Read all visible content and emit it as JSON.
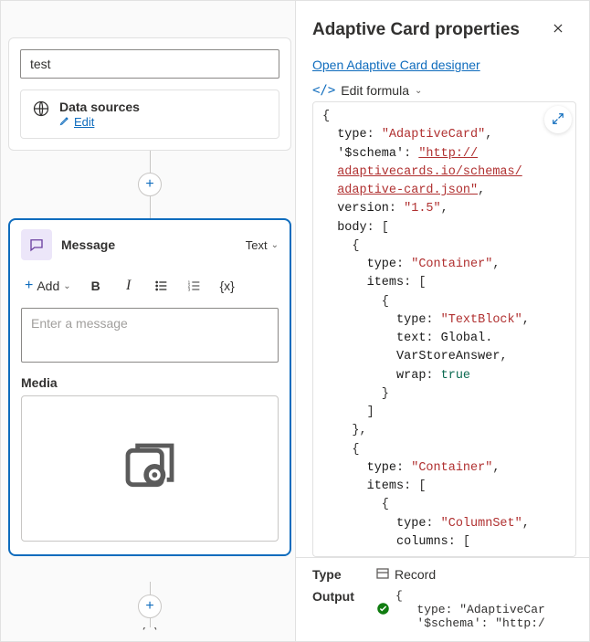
{
  "canvas": {
    "search_value": "test",
    "data_sources": {
      "title": "Data sources",
      "edit_label": "Edit"
    },
    "message_node": {
      "title": "Message",
      "type_label": "Text",
      "toolbar": {
        "add_label": "Add",
        "bold": "B",
        "italic": "I",
        "var_braces": "{x}"
      },
      "placeholder": "Enter a message",
      "media_label": "Media"
    }
  },
  "panel": {
    "title": "Adaptive Card properties",
    "designer_link": "Open Adaptive Card designer",
    "formula_label": "Edit formula",
    "formula_json": {
      "type": "AdaptiveCard",
      "$schema": "http://adaptivecards.io/schemas/adaptive-card.json",
      "version": "1.5",
      "body": [
        {
          "type": "Container",
          "items": [
            {
              "type": "TextBlock",
              "text_ref": "Global.VarStoreAnswer",
              "wrap": true
            }
          ]
        },
        {
          "type": "Container",
          "items": [
            {
              "type": "ColumnSet",
              "columns": []
            }
          ]
        }
      ]
    },
    "footer": {
      "type_label": "Type",
      "type_value": "Record",
      "output_label": "Output",
      "output_preview": {
        "line1": "{",
        "line2": "type: \"AdaptiveCar",
        "line3": "'$schema': \"http:/"
      }
    }
  }
}
